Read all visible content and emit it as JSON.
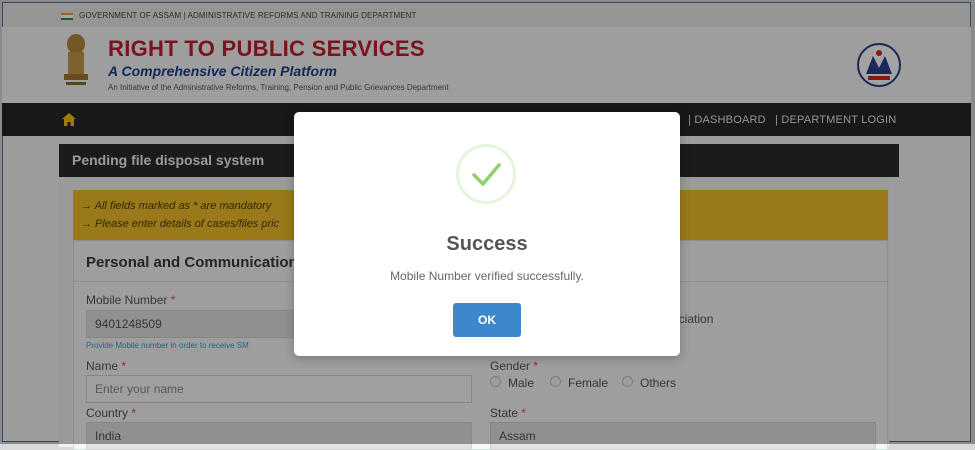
{
  "gov_banner": {
    "text": "GOVERNMENT OF ASSAM | ADMINISTRATIVE REFORMS AND TRAINING DEPARTMENT"
  },
  "header": {
    "title": "RIGHT TO PUBLIC SERVICES",
    "subtitle": "A Comprehensive Citizen Platform",
    "tagline": "An Initiative of the Administrative Reforms, Training, Pension and Public Grievances Department"
  },
  "nav": {
    "items": [
      "| DASHBOARD",
      "| DEPARTMENT LOGIN"
    ],
    "home_icon": "home-icon"
  },
  "card": {
    "title": "Pending file disposal system"
  },
  "notice": {
    "line1": "→ All fields marked as * are mandatory",
    "line2": "→ Please enter details of cases/files pric"
  },
  "form": {
    "section_title": "Personal and Communication D",
    "mobile_label": "Mobile Number",
    "mobile_value": "9401248509",
    "mobile_hint": "Provide Mobile number in order to receive SM",
    "name_label": "Name",
    "name_placeholder": "Enter your name",
    "country_label": "Country",
    "country_value": "India",
    "gender_label": "Gender",
    "gender_options": [
      "Male",
      "Female",
      "Others"
    ],
    "state_label": "State",
    "state_value": "Assam",
    "association_fragment": "sociation",
    "required_mark": "*"
  },
  "modal": {
    "title": "Success",
    "message": "Mobile Number verified successfully.",
    "ok_label": "OK",
    "icon": "check-icon"
  },
  "colors": {
    "title_red": "#c0202e",
    "subtitle_blue": "#1a3e8c",
    "navbar": "#262626",
    "notice_yellow": "#efbe2a",
    "ok_button": "#3d88cc",
    "success_green": "#8fd16b"
  }
}
